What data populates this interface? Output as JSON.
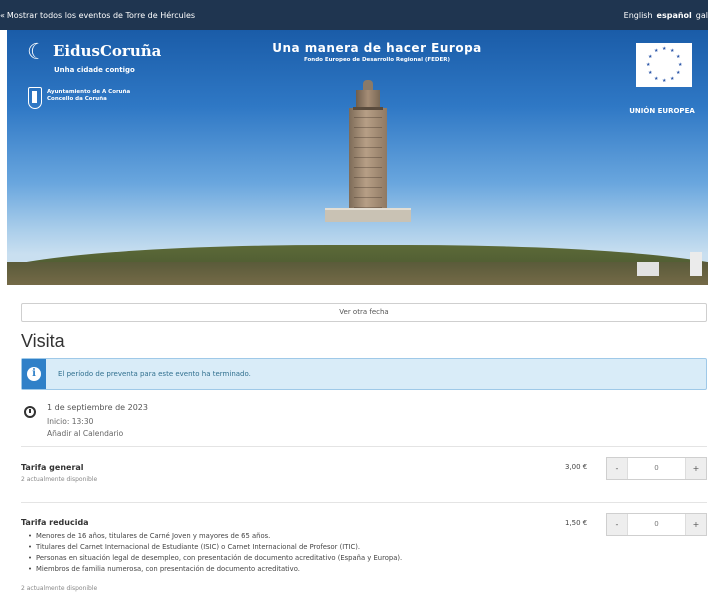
{
  "topbar": {
    "back_arrow": "«",
    "back_link": "Mostrar todos los eventos de Torre de Hércules",
    "languages": [
      {
        "label": "English",
        "active": false
      },
      {
        "label": "español",
        "active": true
      },
      {
        "label": "gal",
        "active": false
      }
    ]
  },
  "banner": {
    "logo_title": "EidusCoruña",
    "logo_subtitle": "Unha cidade contigo",
    "ayuntamiento": [
      "Ayuntamiento de A Coruña",
      "Concello da Coruña"
    ],
    "eu_title": "Una manera de hacer Europa",
    "eu_subtitle": "Fondo Europeo de Desarrollo Regional (FEDER)",
    "eu_label": "UNIÓN EUROPEA",
    "icons": [
      "eidus-logo-icon",
      "city-shield-icon",
      "eu-flag-icon"
    ]
  },
  "other_date_button": "Ver otra fecha",
  "event": {
    "title": "Visita",
    "alert_icon": "i",
    "alert_message": "El período de preventa para este evento ha terminado.",
    "date": "1 de septiembre de 2023",
    "start": "Inicio: 13:30",
    "add_calendar": "Añadir al Calendario"
  },
  "rates": [
    {
      "name": "Tarifa general",
      "availability": "2 actualmente disponible",
      "price": "3,00 €",
      "minus": "-",
      "plus": "+",
      "quantity": "0"
    },
    {
      "name": "Tarifa reducida",
      "price": "1,50 €",
      "minus": "-",
      "plus": "+",
      "quantity": "0",
      "conditions": [
        "Menores de 16 años, titulares de Carné Joven y mayores de 65 años.",
        "Titulares del Carnet Internacional de Estudiante (ISIC) o Carnet Internacional de Profesor (ITIC).",
        "Personas en situación legal de desempleo, con presentación de documento acreditativo (España y Europa).",
        "Miembros de familia numerosa, con presentación de documento acreditativo."
      ],
      "availability": "2 actualmente disponible"
    }
  ]
}
